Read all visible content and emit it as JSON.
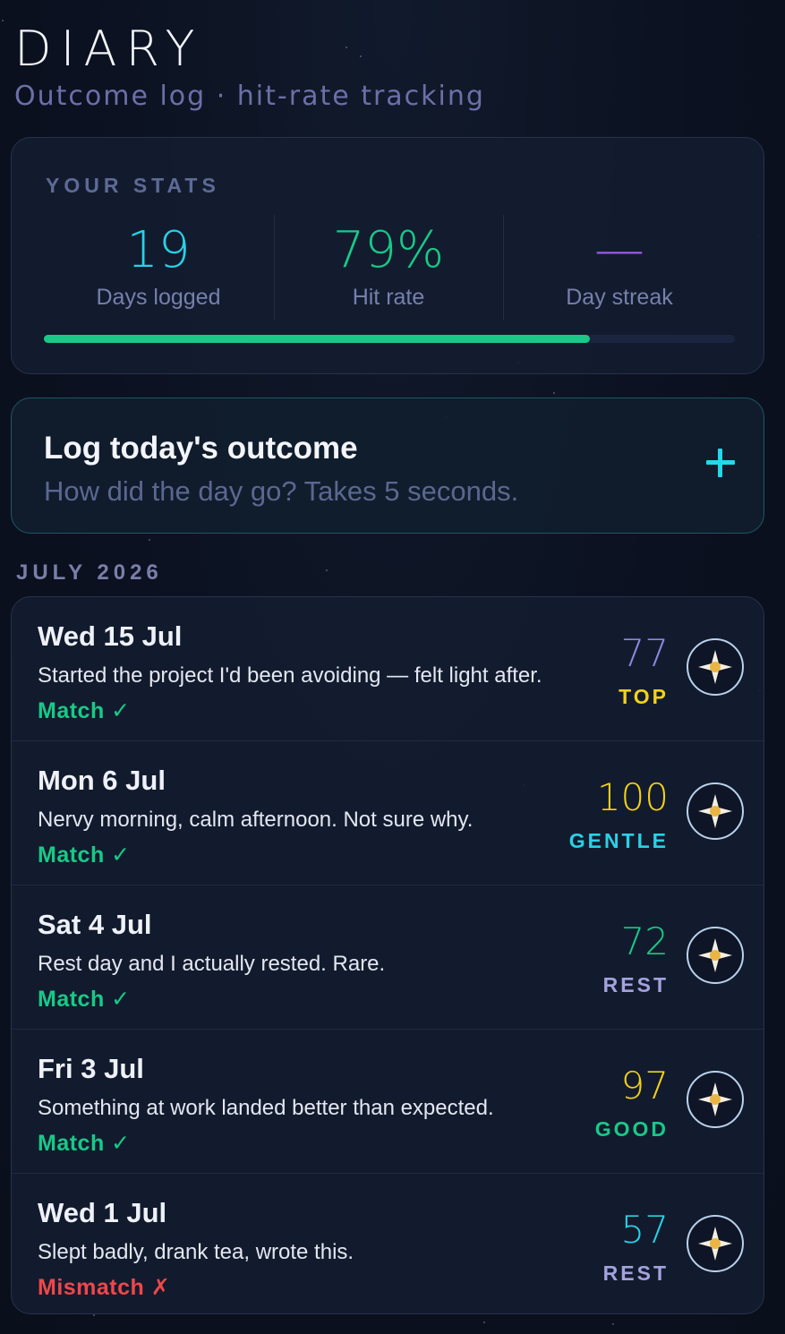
{
  "header": {
    "title": "DIARY",
    "subtitle": "Outcome log · hit-rate tracking"
  },
  "stats": {
    "heading": "YOUR STATS",
    "days_logged": {
      "value": "19",
      "label": "Days logged",
      "color": "#2ad1e6"
    },
    "hit_rate": {
      "value": "79%",
      "label": "Hit rate",
      "color": "#19c987"
    },
    "day_streak": {
      "value": "—",
      "label": "Day streak",
      "color": "#9a5ae8"
    },
    "progress_fraction": 0.79,
    "progress_color": "#19c987"
  },
  "log_card": {
    "title": "Log today's outcome",
    "subtitle": "How did the day go? Takes 5 seconds.",
    "action_icon": "plus-icon"
  },
  "month": {
    "label": "JULY 2026"
  },
  "entries": [
    {
      "date": "Wed 15 Jul",
      "note": "Started the project I'd been avoiding — felt light after.",
      "result": "Match ✓",
      "result_color": "#19c987",
      "score": "77",
      "score_color": "#8b87e2",
      "tag": "TOP",
      "tag_color": "#f2d11c",
      "icon": "compass-star-icon"
    },
    {
      "date": "Mon 6 Jul",
      "note": "Nervy morning, calm afternoon. Not sure why.",
      "result": "Match ✓",
      "result_color": "#19c987",
      "score": "100",
      "score_color": "#f2d11c",
      "tag": "GENTLE",
      "tag_color": "#2ad1e6",
      "icon": "compass-star-icon"
    },
    {
      "date": "Sat 4 Jul",
      "note": "Rest day and I actually rested. Rare.",
      "result": "Match ✓",
      "result_color": "#19c987",
      "score": "72",
      "score_color": "#19c987",
      "tag": "REST",
      "tag_color": "#a4a2de",
      "icon": "compass-star-icon"
    },
    {
      "date": "Fri 3 Jul",
      "note": "Something at work landed better than expected.",
      "result": "Match ✓",
      "result_color": "#19c987",
      "score": "97",
      "score_color": "#f2d11c",
      "tag": "GOOD",
      "tag_color": "#19c987",
      "icon": "compass-star-icon"
    },
    {
      "date": "Wed 1 Jul",
      "note": "Slept badly, drank tea, wrote this.",
      "result": "Mismatch ✗",
      "result_color": "#f0474b",
      "score": "57",
      "score_color": "#2ad1e6",
      "tag": "REST",
      "tag_color": "#a4a2de",
      "icon": "compass-star-icon"
    }
  ]
}
